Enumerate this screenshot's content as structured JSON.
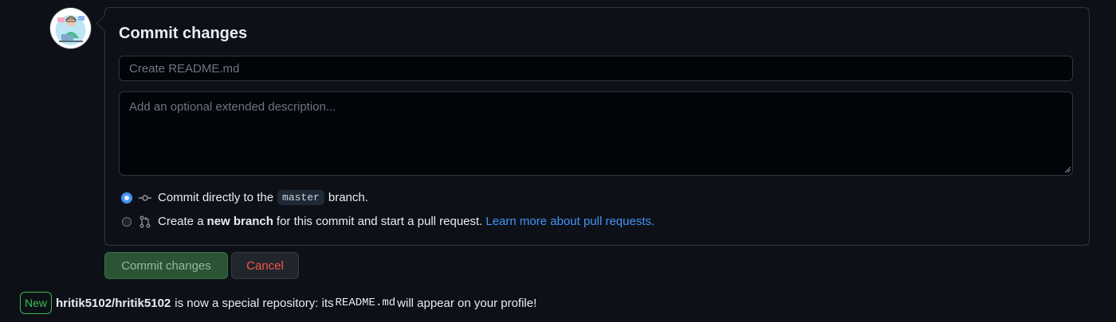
{
  "commit_form": {
    "title": "Commit changes",
    "summary_placeholder": "Create README.md",
    "summary_value": "",
    "description_placeholder": "Add an optional extended description...",
    "description_value": "",
    "options": [
      {
        "label_before": "Commit directly to the",
        "branch_name": "master",
        "label_after": "branch.",
        "selected": true,
        "icon": "git-commit-icon"
      },
      {
        "label_before": "Create a",
        "label_bold": "new branch",
        "label_after": "for this commit and start a pull request.",
        "link": "Learn more about pull requests.",
        "selected": false,
        "icon": "git-pull-request-icon"
      }
    ]
  },
  "actions": {
    "commit_label": "Commit changes",
    "cancel_label": "Cancel"
  },
  "notice": {
    "badge": "New",
    "repo": "hritik5102/hritik5102",
    "text_before": "is now a special repository: its",
    "file": "README.md",
    "text_after": "will appear on your profile!"
  },
  "colors": {
    "accent": "#4493f8",
    "success": "#3fb950",
    "danger": "#f85149",
    "background": "#0d1117"
  }
}
